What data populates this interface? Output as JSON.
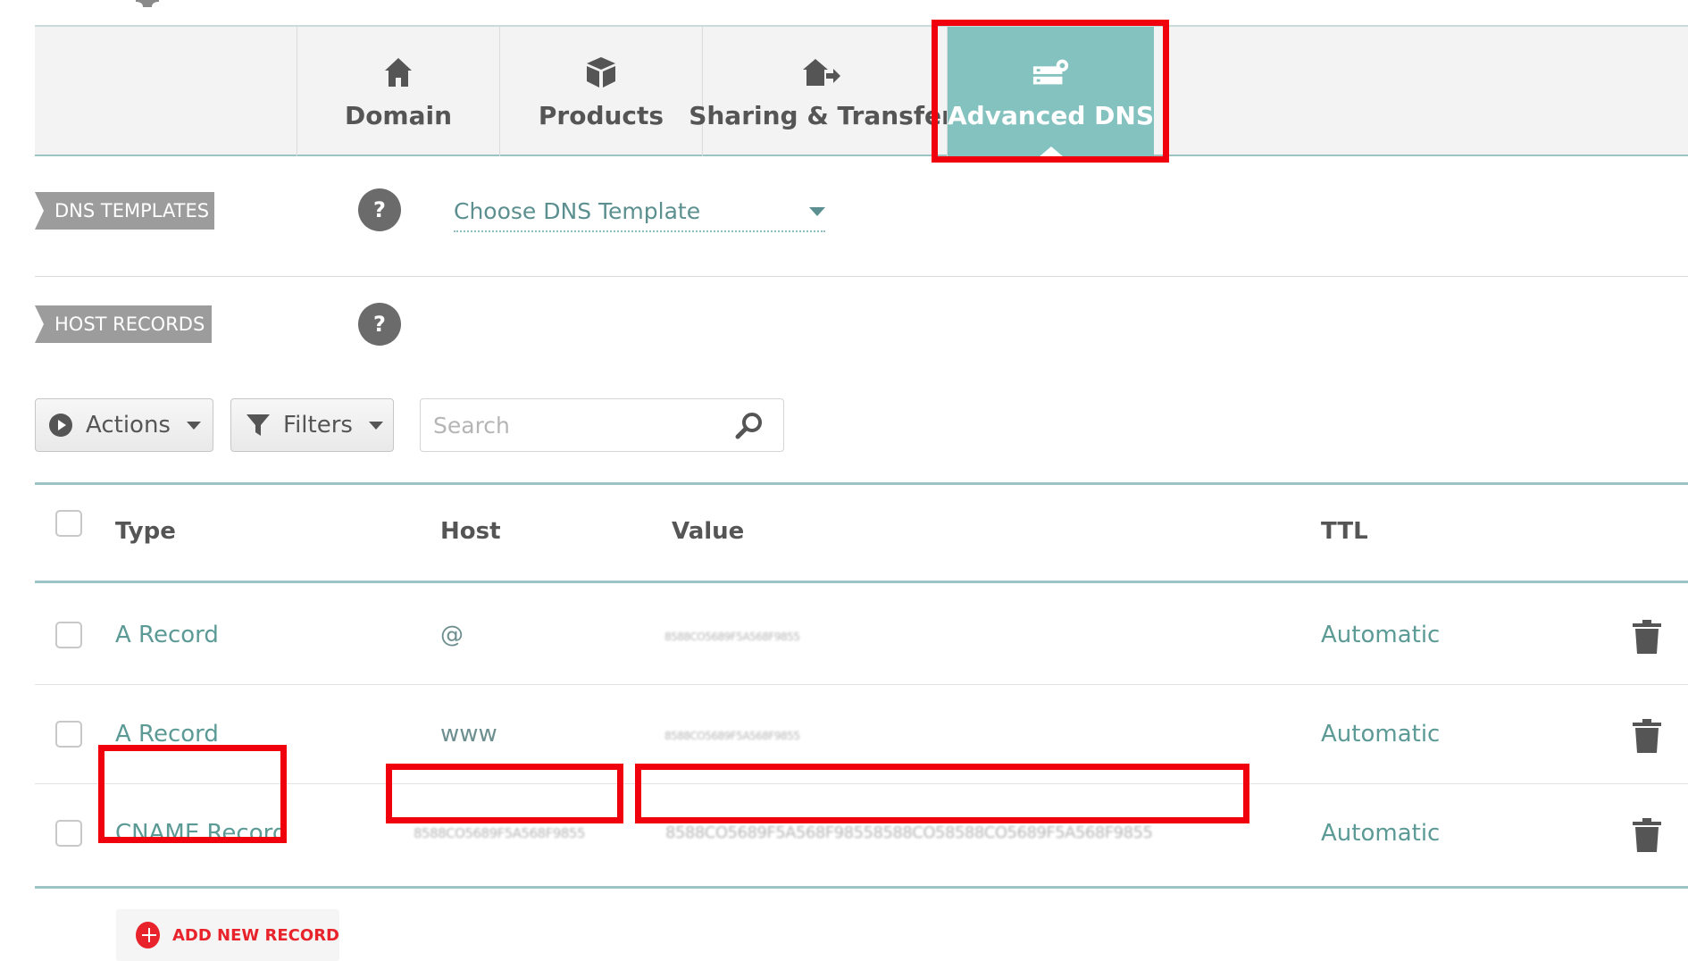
{
  "tabs": [
    {
      "label": "Domain",
      "icon": "home-icon"
    },
    {
      "label": "Products",
      "icon": "box-icon"
    },
    {
      "label": "Sharing & Transfer",
      "icon": "house-arrow-icon"
    },
    {
      "label": "Advanced DNS",
      "icon": "server-gear-icon",
      "active": true
    }
  ],
  "dns_templates": {
    "label": "DNS TEMPLATES",
    "help": "?",
    "select_value": "Choose DNS Template"
  },
  "host_records": {
    "label": "HOST RECORDS",
    "help": "?"
  },
  "toolbar": {
    "actions_label": "Actions",
    "filters_label": "Filters",
    "search_placeholder": "Search"
  },
  "table": {
    "headers": {
      "type": "Type",
      "host": "Host",
      "value": "Value",
      "ttl": "TTL"
    },
    "rows": [
      {
        "type": "A Record",
        "host": "@",
        "value": "8588CO5689F5A568F9855",
        "ttl": "Automatic"
      },
      {
        "type": "A Record",
        "host": "www",
        "value": "8588CO5689F5A568F9855",
        "ttl": "Automatic"
      },
      {
        "type": "CNAME Record",
        "host": "8588CO5689F5A568F9855",
        "value": "8588CO5689F5A568F98558588CO58588CO5689F5A568F9855",
        "ttl": "Automatic"
      }
    ]
  },
  "add_record_label": "ADD NEW RECORD",
  "colors": {
    "accent_teal": "#83c2be",
    "highlight_red": "#f0000c",
    "add_red": "#e8232b"
  }
}
